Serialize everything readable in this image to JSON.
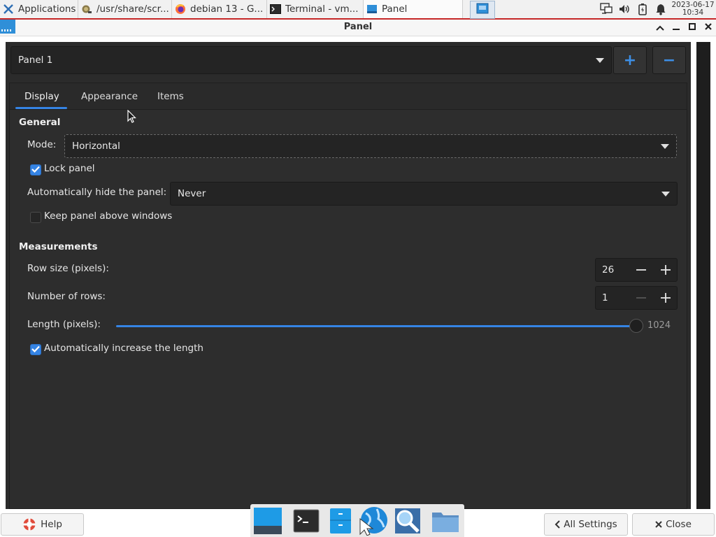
{
  "taskbar": {
    "apps": [
      {
        "label": "Applications",
        "icon": "xfce-mouse-icon"
      },
      {
        "label": "/usr/share/scr...",
        "icon": "image-viewer-icon"
      },
      {
        "label": "debian 13 - G...",
        "icon": "firefox-icon"
      },
      {
        "label": "Terminal - vm...",
        "icon": "terminal-icon"
      },
      {
        "label": "Panel",
        "icon": "panel-icon"
      }
    ],
    "clock_date": "2023-06-17",
    "clock_time": "10:34"
  },
  "window": {
    "title": "Panel"
  },
  "panel_selector": {
    "value": "Panel 1",
    "add_label": "+",
    "remove_label": "−"
  },
  "tabs": [
    "Display",
    "Appearance",
    "Items"
  ],
  "general": {
    "heading": "General",
    "mode_label": "Mode:",
    "mode_value": "Horizontal",
    "lock_label": "Lock panel",
    "lock_checked": true,
    "autohide_label": "Automatically hide the panel:",
    "autohide_value": "Never",
    "keep_above_label": "Keep panel above windows",
    "keep_above_checked": false
  },
  "measurements": {
    "heading": "Measurements",
    "row_size_label": "Row size (pixels):",
    "row_size_value": "26",
    "rows_label": "Number of rows:",
    "rows_value": "1",
    "length_label": "Length (pixels):",
    "length_value": "1024",
    "length_fraction": 1.0,
    "auto_increase_label": "Automatically increase the length",
    "auto_increase_checked": true
  },
  "footer": {
    "help_label": "Help",
    "all_settings_label": "All Settings",
    "close_label": "Close"
  },
  "dock": {
    "items": [
      "desktop-icon",
      "terminal-icon",
      "file-manager-icon",
      "web-browser-icon",
      "search-icon",
      "folder-icon"
    ]
  },
  "colors": {
    "accent": "#3584e4",
    "background": "#2b2b2b",
    "taskbar_border": "#c62828"
  }
}
